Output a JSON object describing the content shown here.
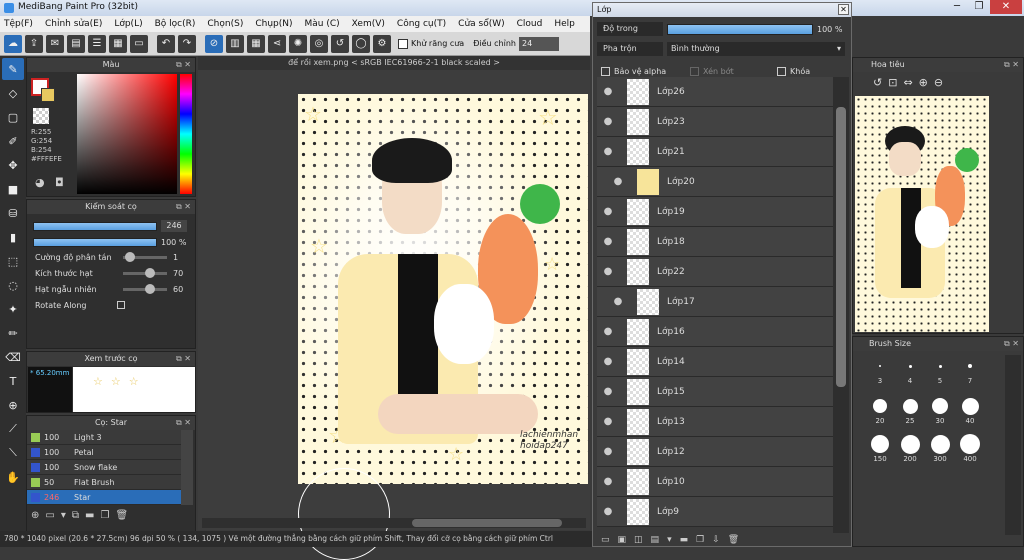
{
  "app": {
    "title": "MediBang Paint Pro (32bit)"
  },
  "menu": [
    "Tệp(F)",
    "Chỉnh sửa(E)",
    "Lớp(L)",
    "Bộ lọc(R)",
    "Chọn(S)",
    "Chụp(N)",
    "Màu (C)",
    "Xem(V)",
    "Công cụ(T)",
    "Cửa sổ(W)",
    "Cloud",
    "Help"
  ],
  "toolbar": {
    "antialias_label": "Khử răng cưa",
    "adjust_label": "Điều chỉnh",
    "adjust_value": "24"
  },
  "color_panel": {
    "title": "Màu",
    "r": "R:255",
    "g": "G:254",
    "b": "B:254",
    "hex": "#FFFEFE",
    "accent": "#cc2222"
  },
  "brush_control": {
    "title": "Kiểm soát cọ",
    "size_value": "246",
    "opacity_value": "100 %",
    "rows": [
      {
        "label": "Cường độ phân tán",
        "value": "1"
      },
      {
        "label": "Kích thước hạt",
        "value": "70"
      },
      {
        "label": "Hạt ngẫu nhiên",
        "value": "60"
      },
      {
        "label": "Rotate Along",
        "value": ""
      }
    ]
  },
  "brush_preview": {
    "title": "Xem trước cọ",
    "size": "65.20mm"
  },
  "brush_panel": {
    "title": "Cọ: Star",
    "items": [
      {
        "size": "100",
        "name": "Light 3",
        "color": "#99cc55"
      },
      {
        "size": "100",
        "name": "Petal",
        "color": "#3355cc"
      },
      {
        "size": "100",
        "name": "Snow flake",
        "color": "#3355cc"
      },
      {
        "size": "50",
        "name": "Flat Brush",
        "color": "#99cc55"
      },
      {
        "size": "246",
        "name": "Star",
        "color": "#3355cc"
      }
    ]
  },
  "document": {
    "tab": "để rồi xem.png < sRGB IEC61966-2-1 black scaled >",
    "sign1": "lachienmhan",
    "sign2": "hoidap247"
  },
  "layer_panel": {
    "title": "Lớp",
    "opacity_label": "Độ trong",
    "opacity_value": "100 %",
    "blend_label": "Pha trộn",
    "blend_value": "Bình thường",
    "protect_alpha": "Bảo vệ alpha",
    "clipping": "Xén bớt",
    "lock": "Khóa",
    "layers": [
      "Lớp26",
      "Lớp23",
      "Lớp21",
      "Lớp20",
      "Lớp19",
      "Lớp18",
      "Lớp22",
      "Lớp17",
      "Lớp16",
      "Lớp14",
      "Lớp15",
      "Lớp13",
      "Lớp12",
      "Lớp10",
      "Lớp9"
    ]
  },
  "navigator": {
    "title": "Hoa tiêu"
  },
  "brush_size_panel": {
    "title": "Brush Size",
    "sizes_row1": [
      "3",
      "4",
      "5",
      "7"
    ],
    "sizes_row2": [
      "20",
      "25",
      "30",
      "40"
    ],
    "sizes_row3": [
      "150",
      "200",
      "300",
      "400"
    ]
  },
  "status": {
    "text": "780 * 1040 pixel   (20.6 * 27.5cm)   96 dpi   50 %   ( 134, 1075 )   Vẽ một đường thẳng bằng cách giữ phím Shift, Thay đổi cỡ cọ bằng cách giữ phím Ctrl"
  }
}
